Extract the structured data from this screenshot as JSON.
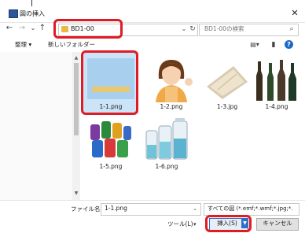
{
  "window": {
    "title": "図の挿入",
    "close_label": "✕"
  },
  "nav": {
    "back": "←",
    "forward": "→",
    "recent": "⌄",
    "up": "↑"
  },
  "address": {
    "path": "BD1-00",
    "chevron": "⌄",
    "refresh": "↻"
  },
  "search": {
    "placeholder": "BD1-00の検索",
    "icon_glyph": "⌕"
  },
  "toolbar": {
    "organize_label": "整理 ▾",
    "newfolder_label": "新しいフォルダー",
    "view_glyph": "▤▾",
    "pane_glyph": "▮",
    "help_glyph": "?"
  },
  "scroll": {
    "up": "▲",
    "down": "▼"
  },
  "files": [
    {
      "name": "1-1.png",
      "selected": true
    },
    {
      "name": "1-2.png",
      "selected": false
    },
    {
      "name": "1-3.jpg",
      "selected": false
    },
    {
      "name": "1-4.png",
      "selected": false
    },
    {
      "name": "1-5.png",
      "selected": false
    },
    {
      "name": "1-6.png",
      "selected": false
    }
  ],
  "bottom": {
    "filename_label": "ファイル名(N):",
    "filename_value": "1-1.png",
    "filename_chevron": "⌄",
    "filter_value": "すべての図 (*.emf;*.wmf;*.jpg;*.jp",
    "tools_label": "ツール(L)",
    "tools_chevron": "▾",
    "insert_label": "挿入(S)",
    "insert_drop": "▼",
    "cancel_label": "キャンセル"
  },
  "colors": {
    "highlight": "#e01b24",
    "accent": "#2f6fc8",
    "selection": "#cce4f7"
  }
}
